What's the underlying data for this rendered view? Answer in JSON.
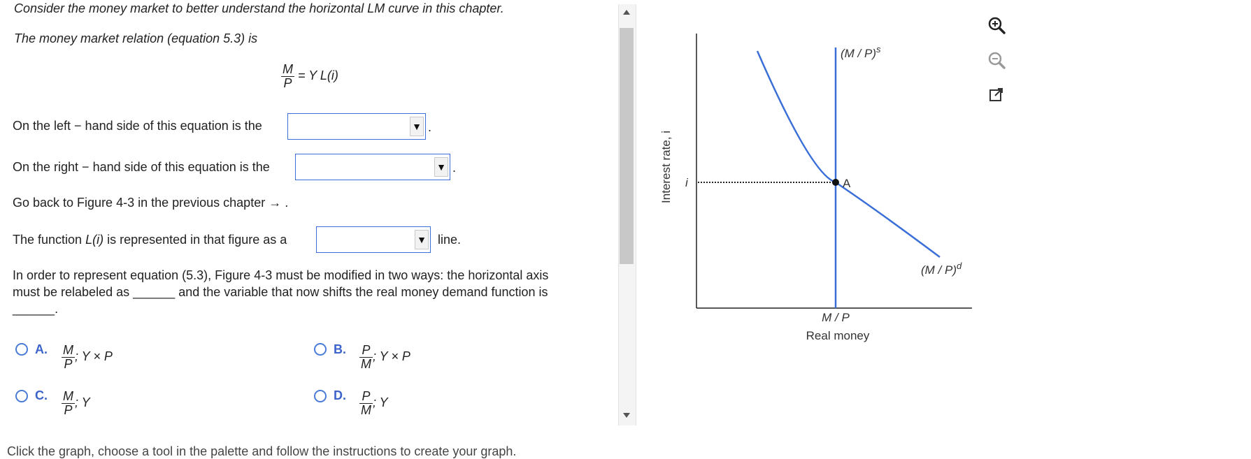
{
  "question": {
    "intro": "Consider the money market to better understand the horizontal LM curve in this chapter.",
    "relation_text": "The money market relation (equation 5.3) is",
    "equation": {
      "num": "M",
      "den": "P",
      "rhs": "= Y L(i)"
    },
    "lhs_prefix": "On the left − hand side of this equation is the",
    "lhs_suffix": ".",
    "rhs_prefix": "On the right − hand side of this equation is the",
    "rhs_suffix": ".",
    "goback": "Go back to Figure 4-3 in the previous chapter → .",
    "func_prefix": "The function",
    "func_name": "L(i)",
    "func_middle": "is represented in that figure as a",
    "func_suffix": "line.",
    "order_line1": "In order to represent equation (5.3), Figure 4-3 must be modified in two ways: the horizontal axis",
    "order_line2a": "must be relabeled as",
    "order_blank": "______",
    "order_line2b": "and the variable that now shifts the real money demand function is",
    "order_line3": "______."
  },
  "options": [
    {
      "letter": "A.",
      "num": "M",
      "den": "P",
      "tail": "; Y × P"
    },
    {
      "letter": "B.",
      "num": "P",
      "den": "M",
      "tail": "; Y × P"
    },
    {
      "letter": "C.",
      "num": "M",
      "den": "P",
      "tail": "; Y"
    },
    {
      "letter": "D.",
      "num": "P",
      "den": "M",
      "tail": "; Y"
    }
  ],
  "graph": {
    "y_axis_label": "Interest rate, i",
    "x_tick_label": "M / P",
    "x_axis_label": "Real money",
    "supply_label": "(M / P)",
    "supply_sup": "s",
    "demand_label": "(M / P)",
    "demand_sup": "d",
    "point_label": "A",
    "i_label": "i",
    "curve_color": "#3a6fd8"
  },
  "tools": [
    "zoom-in-icon",
    "zoom-out-icon",
    "popout-icon"
  ],
  "footer": "Click the graph, choose a tool in the palette and follow the instructions to create your graph."
}
